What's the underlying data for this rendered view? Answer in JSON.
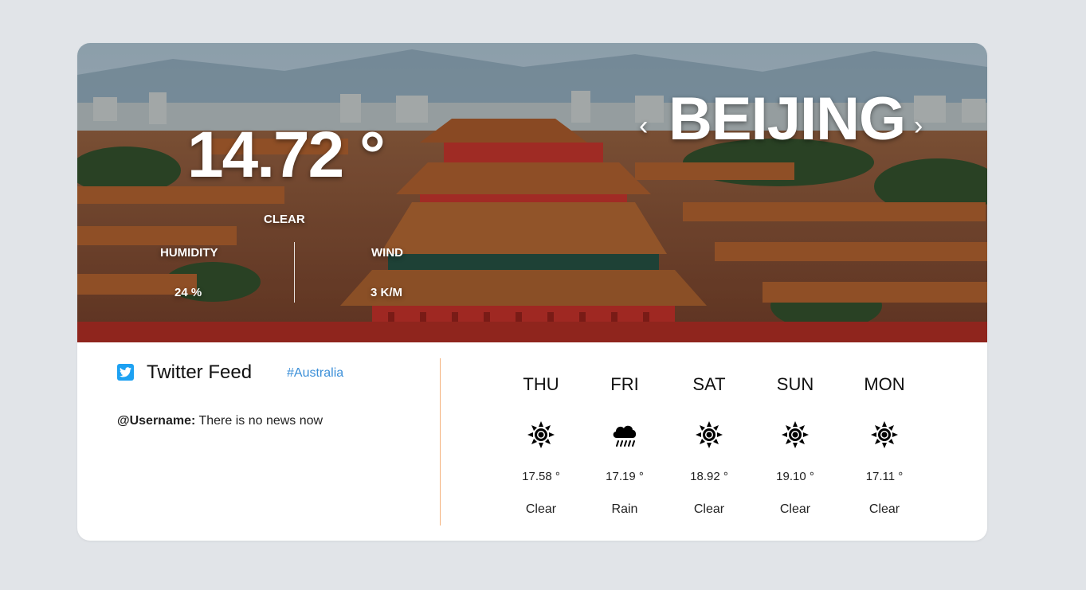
{
  "hero": {
    "temperature": "14.72 °",
    "condition": "CLEAR",
    "humidity_label": "HUMIDITY",
    "humidity_value": "24 %",
    "wind_label": "WIND",
    "wind_value": "3 K/M",
    "city": "BEIJING",
    "prev_icon": "chevron-left-icon",
    "next_icon": "chevron-right-icon",
    "prev_glyph": "‹",
    "next_glyph": "›"
  },
  "twitter": {
    "icon": "twitter-icon",
    "title": "Twitter Feed",
    "hashtag": "#Australia",
    "feed": [
      {
        "user": "@Username:",
        "text": " There is no news now"
      }
    ]
  },
  "forecast": [
    {
      "day": "THU",
      "icon": "sun-icon",
      "temp": "17.58 °",
      "desc": "Clear"
    },
    {
      "day": "FRI",
      "icon": "rain-cloud-icon",
      "temp": "17.19 °",
      "desc": "Rain"
    },
    {
      "day": "SAT",
      "icon": "sun-icon",
      "temp": "18.92 °",
      "desc": "Clear"
    },
    {
      "day": "SUN",
      "icon": "sun-icon",
      "temp": "19.10 °",
      "desc": "Clear"
    },
    {
      "day": "MON",
      "icon": "sun-icon",
      "temp": "17.11 °",
      "desc": "Clear"
    }
  ],
  "colors": {
    "page_bg": "#e1e4e8",
    "card_bg": "#ffffff",
    "twitter_blue": "#1da1f2",
    "hashtag": "#3b8fd8",
    "divider_accent": "#f5b27c"
  }
}
